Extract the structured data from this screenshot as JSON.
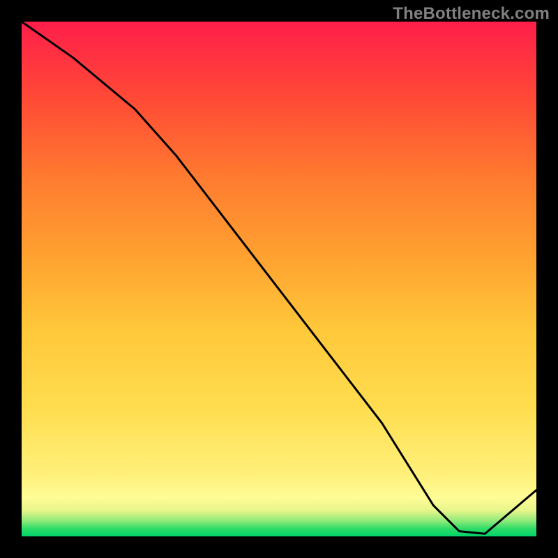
{
  "watermark": "TheBottleneck.com",
  "bottom_tag": "",
  "chart_data": {
    "type": "line",
    "title": "",
    "xlabel": "",
    "ylabel": "",
    "xlim": [
      0,
      100
    ],
    "ylim": [
      0,
      100
    ],
    "grid": false,
    "legend": false,
    "series": [
      {
        "name": "curve",
        "x": [
          0,
          10,
          22,
          30,
          40,
          50,
          60,
          70,
          75,
          80,
          85,
          90,
          100
        ],
        "y": [
          100,
          93,
          83,
          74,
          61,
          48,
          35,
          22,
          14,
          6,
          1,
          0.5,
          9
        ]
      }
    ],
    "background_gradient_stops": [
      {
        "pos": 0.0,
        "color": "#00d46a"
      },
      {
        "pos": 0.015,
        "color": "#2fdc67"
      },
      {
        "pos": 0.03,
        "color": "#8eea7b"
      },
      {
        "pos": 0.05,
        "color": "#e7f58a"
      },
      {
        "pos": 0.075,
        "color": "#fffc96"
      },
      {
        "pos": 0.12,
        "color": "#fff07a"
      },
      {
        "pos": 0.25,
        "color": "#ffdd4f"
      },
      {
        "pos": 0.4,
        "color": "#ffc83a"
      },
      {
        "pos": 0.55,
        "color": "#ffa030"
      },
      {
        "pos": 0.7,
        "color": "#ff7a30"
      },
      {
        "pos": 0.85,
        "color": "#ff4a36"
      },
      {
        "pos": 1.0,
        "color": "#ff1e4a"
      }
    ],
    "minimum_marker": {
      "x": 88,
      "y": 0.5
    }
  }
}
